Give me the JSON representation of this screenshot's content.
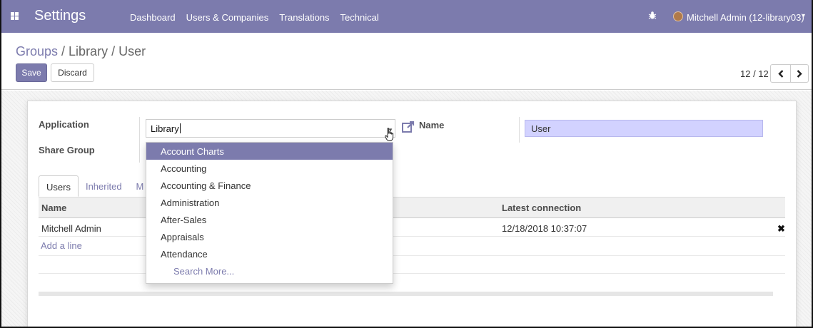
{
  "navbar": {
    "app_title": "Settings",
    "menu": [
      "Dashboard",
      "Users & Companies",
      "Translations",
      "Technical"
    ],
    "user": "Mitchell Admin (12-library03)",
    "apps_icon": "apps-grid-icon",
    "debug_icon": "bug-icon",
    "user_caret": "▾",
    "color": "#7c7bad"
  },
  "breadcrumb": {
    "group": "Groups",
    "separator_1": " / ",
    "category": "Library",
    "separator_2": " / ",
    "current": "User"
  },
  "toolbar": {
    "save_label": "Save",
    "discard_label": "Discard",
    "pager": "12 / 12"
  },
  "form": {
    "application_label": "Application",
    "application_value": "Library",
    "share_group_label": "Share Group",
    "name_label": "Name",
    "name_value": "User"
  },
  "tabs": [
    "Users",
    "Inherited",
    "M"
  ],
  "table": {
    "columns": {
      "name": "Name",
      "latest_connection": "Latest connection"
    },
    "rows": [
      {
        "name": "Mitchell Admin",
        "latest_connection": "12/18/2018 10:37:07"
      }
    ],
    "add_line": "Add a line",
    "delete_icon": "✖"
  },
  "dropdown": {
    "options": [
      "Account Charts",
      "Accounting",
      "Accounting & Finance",
      "Administration",
      "After-Sales",
      "Appraisals",
      "Attendance"
    ],
    "selected_index": 0,
    "search_more": "Search More..."
  }
}
